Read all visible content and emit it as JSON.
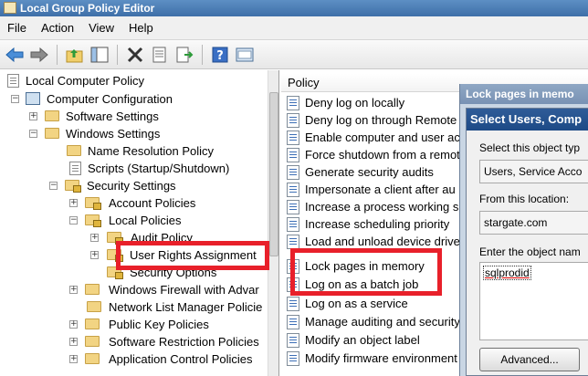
{
  "window": {
    "title": "Local Group Policy Editor"
  },
  "menu": [
    "File",
    "Action",
    "View",
    "Help"
  ],
  "toolbar": {
    "icons": [
      "back-arrow-icon",
      "forward-arrow-icon",
      "up-folder-icon",
      "show-hide-tree-icon",
      "delete-icon",
      "properties-icon",
      "export-list-icon",
      "help-icon",
      "console-icon"
    ]
  },
  "tree": {
    "items": [
      {
        "label": "Local Computer Policy",
        "icon": "policy-doc"
      },
      {
        "label": "Computer Configuration",
        "icon": "computer"
      },
      {
        "label": "Software Settings",
        "icon": "folder"
      },
      {
        "label": "Windows Settings",
        "icon": "folder"
      },
      {
        "label": "Name Resolution Policy",
        "icon": "folder"
      },
      {
        "label": "Scripts (Startup/Shutdown)",
        "icon": "doc"
      },
      {
        "label": "Security Settings",
        "icon": "folder-lock"
      },
      {
        "label": "Account Policies",
        "icon": "folder-lock"
      },
      {
        "label": "Local Policies",
        "icon": "folder-lock"
      },
      {
        "label": "Audit Policy",
        "icon": "folder-lock"
      },
      {
        "label": "User Rights Assignment",
        "icon": "folder-lock"
      },
      {
        "label": "Security Options",
        "icon": "folder-lock"
      },
      {
        "label": "Windows Firewall with Advar",
        "icon": "folder"
      },
      {
        "label": "Network List Manager Policie",
        "icon": "folder"
      },
      {
        "label": "Public Key Policies",
        "icon": "folder"
      },
      {
        "label": "Software Restriction Policies",
        "icon": "folder"
      },
      {
        "label": "Application Control Policies",
        "icon": "folder"
      }
    ]
  },
  "policy_list": {
    "header": "Policy",
    "items": [
      "Deny log on locally",
      "Deny log on through Remote",
      "Enable computer and user acc",
      "Force shutdown from a remot",
      "Generate security audits",
      "Impersonate a client after au",
      "Increase a process working se",
      "Increase scheduling priority",
      "Load and unload device driver",
      "Lock pages in memory",
      "Log on as a batch job",
      "Log on as a service",
      "Manage auditing and security",
      "Modify an object label",
      "Modify firmware environment"
    ]
  },
  "properties_dialog": {
    "title": "Lock pages in memo"
  },
  "select_dialog": {
    "title": "Select Users, Comp",
    "object_type_label": "Select this object typ",
    "object_type_value": "Users, Service Acco",
    "location_label": "From this location:",
    "location_value": "stargate.com",
    "object_name_label": "Enter the object nam",
    "object_name_value": "sqlprodid",
    "advanced_button": "Advanced..."
  },
  "highlight_color": "#e8202a"
}
